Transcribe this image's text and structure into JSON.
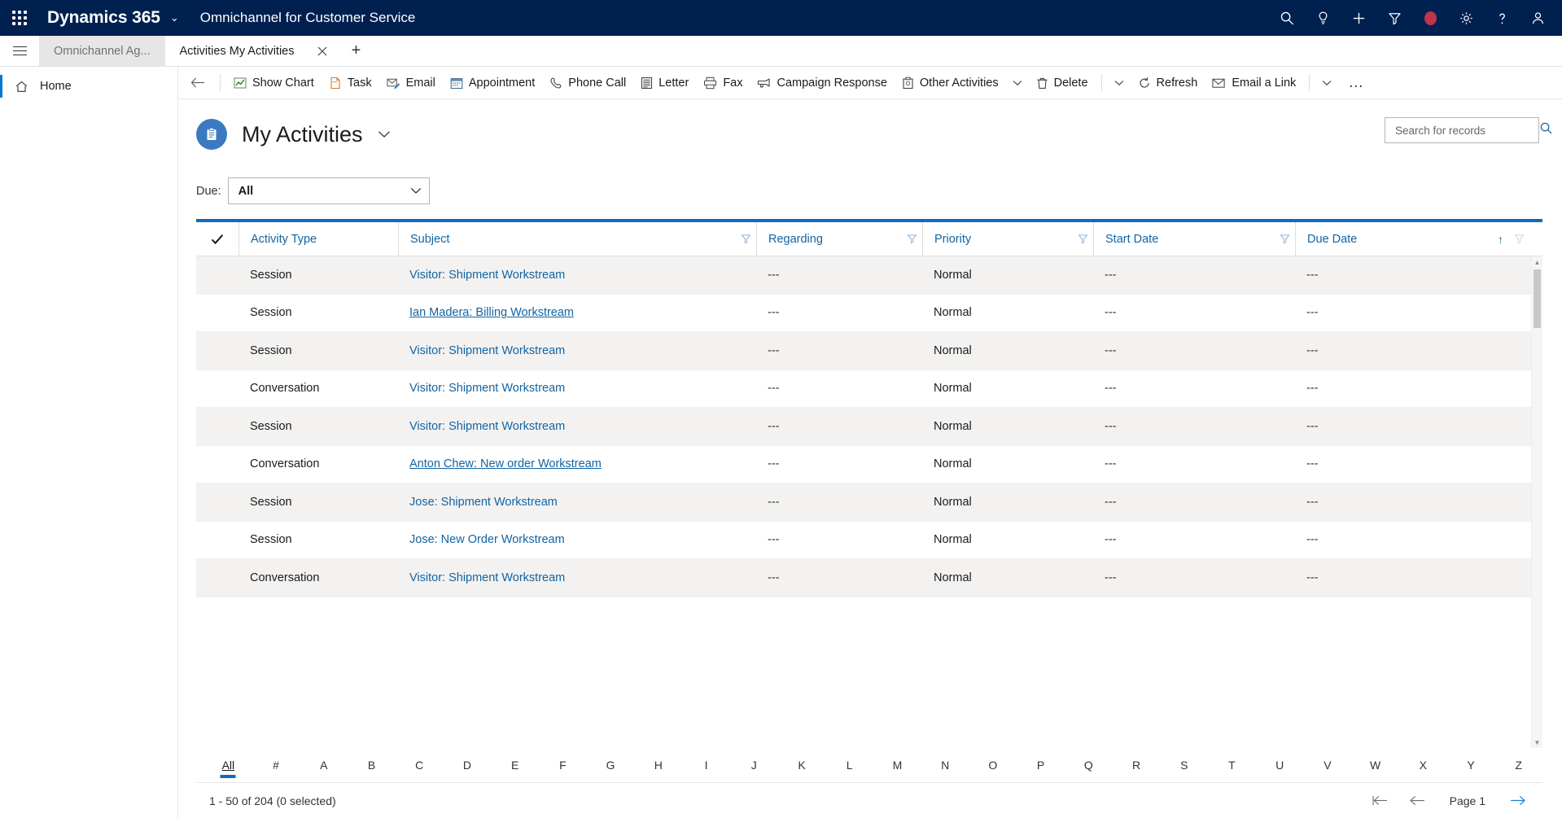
{
  "topbar": {
    "waffle_icon": "app-launcher-icon",
    "brand": "Dynamics 365",
    "brand_chevron": "⌄",
    "app_name": "Omnichannel for Customer Service",
    "right_icons": [
      {
        "name": "search-icon",
        "label": "Search"
      },
      {
        "name": "lightbulb-icon",
        "label": "Insights"
      },
      {
        "name": "plus-icon",
        "label": "Quick create"
      },
      {
        "name": "filter-icon",
        "label": "Filter"
      },
      {
        "name": "recording-indicator-icon",
        "label": "Recording",
        "color": "#c0334a"
      },
      {
        "name": "gear-icon",
        "label": "Settings"
      },
      {
        "name": "help-icon",
        "label": "Help"
      },
      {
        "name": "user-avatar-icon",
        "label": "Account"
      }
    ]
  },
  "tabs": {
    "hamburger_label": "Site map",
    "items": [
      {
        "label": "Omnichannel Ag...",
        "active": false,
        "closable": false
      },
      {
        "label": "Activities My Activities",
        "active": true,
        "closable": true
      }
    ],
    "new_tab_label": "+"
  },
  "sidenav": {
    "items": [
      {
        "label": "Home",
        "icon": "home-icon",
        "selected": true
      }
    ]
  },
  "commandbar": {
    "back_label": "Back",
    "buttons": [
      {
        "label": "Show Chart",
        "icon": "chart-icon"
      },
      {
        "label": "Task",
        "icon": "task-icon"
      },
      {
        "label": "Email",
        "icon": "email-icon"
      },
      {
        "label": "Appointment",
        "icon": "calendar-icon"
      },
      {
        "label": "Phone Call",
        "icon": "phone-icon"
      },
      {
        "label": "Letter",
        "icon": "letter-icon"
      },
      {
        "label": "Fax",
        "icon": "fax-icon"
      },
      {
        "label": "Campaign Response",
        "icon": "campaign-icon"
      },
      {
        "label": "Other Activities",
        "icon": "other-activities-icon",
        "chevron": true
      },
      {
        "label": "Delete",
        "icon": "trash-icon",
        "chevron": true
      },
      {
        "label": "Refresh",
        "icon": "refresh-icon"
      },
      {
        "label": "Email a Link",
        "icon": "email-link-icon",
        "chevron": true
      }
    ],
    "overflow_label": "…"
  },
  "page": {
    "title": "My Activities",
    "title_chevron": "⌄",
    "avatar_icon": "activity-clipboard-icon",
    "search": {
      "placeholder": "Search for records",
      "value": "",
      "icon": "search-icon"
    },
    "filter": {
      "label": "Due:",
      "value": "All",
      "chevron": "⌄"
    }
  },
  "grid": {
    "select_all_icon": "checkmark-icon",
    "columns": [
      {
        "label": "Activity Type",
        "key": "col-type",
        "filter": false,
        "sorted": false
      },
      {
        "label": "Subject",
        "key": "col-subject",
        "filter": true,
        "sorted": false
      },
      {
        "label": "Regarding",
        "key": "col-regard",
        "filter": true,
        "sorted": false
      },
      {
        "label": "Priority",
        "key": "col-priority",
        "filter": true,
        "sorted": false
      },
      {
        "label": "Start Date",
        "key": "col-start",
        "filter": true,
        "sorted": false
      },
      {
        "label": "Due Date",
        "key": "col-due",
        "filter": true,
        "sorted": true,
        "sort_dir": "↑"
      }
    ],
    "rows": [
      {
        "type": "Session",
        "subject": "Visitor: Shipment Workstream",
        "regarding": "---",
        "priority": "Normal",
        "start": "---",
        "due": "---",
        "hovered": false
      },
      {
        "type": "Session",
        "subject": "Ian Madera: Billing Workstream",
        "regarding": "---",
        "priority": "Normal",
        "start": "---",
        "due": "---",
        "hovered": true
      },
      {
        "type": "Session",
        "subject": "Visitor: Shipment Workstream",
        "regarding": "---",
        "priority": "Normal",
        "start": "---",
        "due": "---",
        "hovered": false
      },
      {
        "type": "Conversation",
        "subject": "Visitor: Shipment Workstream",
        "regarding": "---",
        "priority": "Normal",
        "start": "---",
        "due": "---",
        "hovered": false
      },
      {
        "type": "Session",
        "subject": "Visitor: Shipment Workstream",
        "regarding": "---",
        "priority": "Normal",
        "start": "---",
        "due": "---",
        "hovered": false
      },
      {
        "type": "Conversation",
        "subject": "Anton Chew: New order Workstream",
        "regarding": "---",
        "priority": "Normal",
        "start": "---",
        "due": "---",
        "hovered": true
      },
      {
        "type": "Session",
        "subject": "Jose: Shipment Workstream",
        "regarding": "---",
        "priority": "Normal",
        "start": "---",
        "due": "---",
        "hovered": false
      },
      {
        "type": "Session",
        "subject": "Jose: New Order Workstream",
        "regarding": "---",
        "priority": "Normal",
        "start": "---",
        "due": "---",
        "hovered": false
      },
      {
        "type": "Conversation",
        "subject": "Visitor: Shipment Workstream",
        "regarding": "---",
        "priority": "Normal",
        "start": "---",
        "due": "---",
        "hovered": false
      }
    ]
  },
  "alphabar": {
    "items": [
      "All",
      "#",
      "A",
      "B",
      "C",
      "D",
      "E",
      "F",
      "G",
      "H",
      "I",
      "J",
      "K",
      "L",
      "M",
      "N",
      "O",
      "P",
      "Q",
      "R",
      "S",
      "T",
      "U",
      "V",
      "W",
      "X",
      "Y",
      "Z"
    ],
    "active": "All"
  },
  "footer": {
    "record_count": "1 - 50 of 204 (0 selected)",
    "page_label": "Page 1",
    "first_page_icon": "first-page-icon",
    "prev_page_icon": "previous-page-icon",
    "next_page_icon": "next-page-icon",
    "next_enabled": true
  },
  "colors": {
    "nav_bg": "#002050",
    "accent": "#0f6cbd",
    "link": "#1264a3",
    "row_alt": "#f3f2f1",
    "recording": "#c0334a"
  }
}
